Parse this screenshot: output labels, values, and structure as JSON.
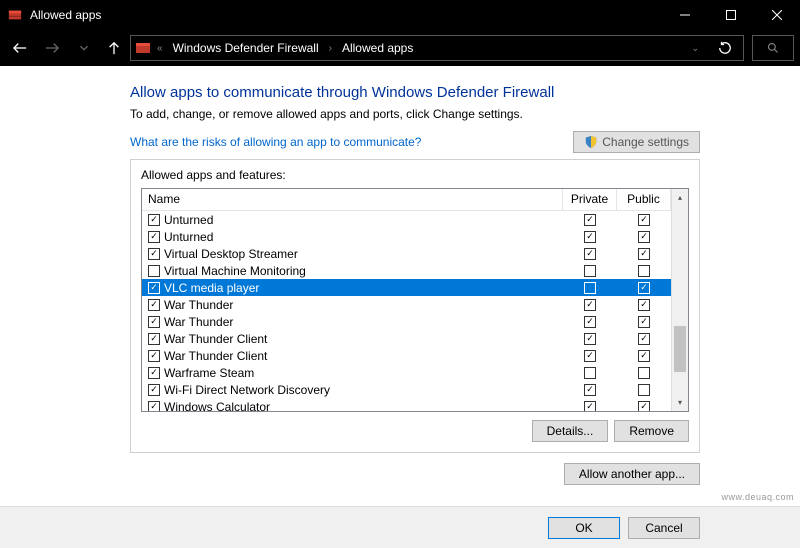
{
  "window": {
    "title": "Allowed apps"
  },
  "breadcrumb": {
    "items": [
      "Windows Defender Firewall",
      "Allowed apps"
    ]
  },
  "page": {
    "title": "Allow apps to communicate through Windows Defender Firewall",
    "subtitle": "To add, change, or remove allowed apps and ports, click Change settings.",
    "link": "What are the risks of allowing an app to communicate?",
    "change_settings": "Change settings",
    "panel_title": "Allowed apps and features:"
  },
  "columns": {
    "name": "Name",
    "private": "Private",
    "public": "Public"
  },
  "rows": [
    {
      "enabled": true,
      "name": "Unturned",
      "private": true,
      "public": true,
      "selected": false
    },
    {
      "enabled": true,
      "name": "Unturned",
      "private": true,
      "public": true,
      "selected": false
    },
    {
      "enabled": true,
      "name": "Virtual Desktop Streamer",
      "private": true,
      "public": true,
      "selected": false
    },
    {
      "enabled": false,
      "name": "Virtual Machine Monitoring",
      "private": false,
      "public": false,
      "selected": false
    },
    {
      "enabled": true,
      "name": "VLC media player",
      "private": false,
      "public": true,
      "selected": true
    },
    {
      "enabled": true,
      "name": "War Thunder",
      "private": true,
      "public": true,
      "selected": false
    },
    {
      "enabled": true,
      "name": "War Thunder",
      "private": true,
      "public": true,
      "selected": false
    },
    {
      "enabled": true,
      "name": "War Thunder Client",
      "private": true,
      "public": true,
      "selected": false
    },
    {
      "enabled": true,
      "name": "War Thunder Client",
      "private": true,
      "public": true,
      "selected": false
    },
    {
      "enabled": true,
      "name": "Warframe Steam",
      "private": false,
      "public": false,
      "selected": false
    },
    {
      "enabled": true,
      "name": "Wi-Fi Direct Network Discovery",
      "private": true,
      "public": false,
      "selected": false
    },
    {
      "enabled": true,
      "name": "Windows Calculator",
      "private": true,
      "public": true,
      "selected": false
    }
  ],
  "buttons": {
    "details": "Details...",
    "remove": "Remove",
    "allow_another": "Allow another app...",
    "ok": "OK",
    "cancel": "Cancel"
  },
  "watermark": "www.deuaq.com"
}
